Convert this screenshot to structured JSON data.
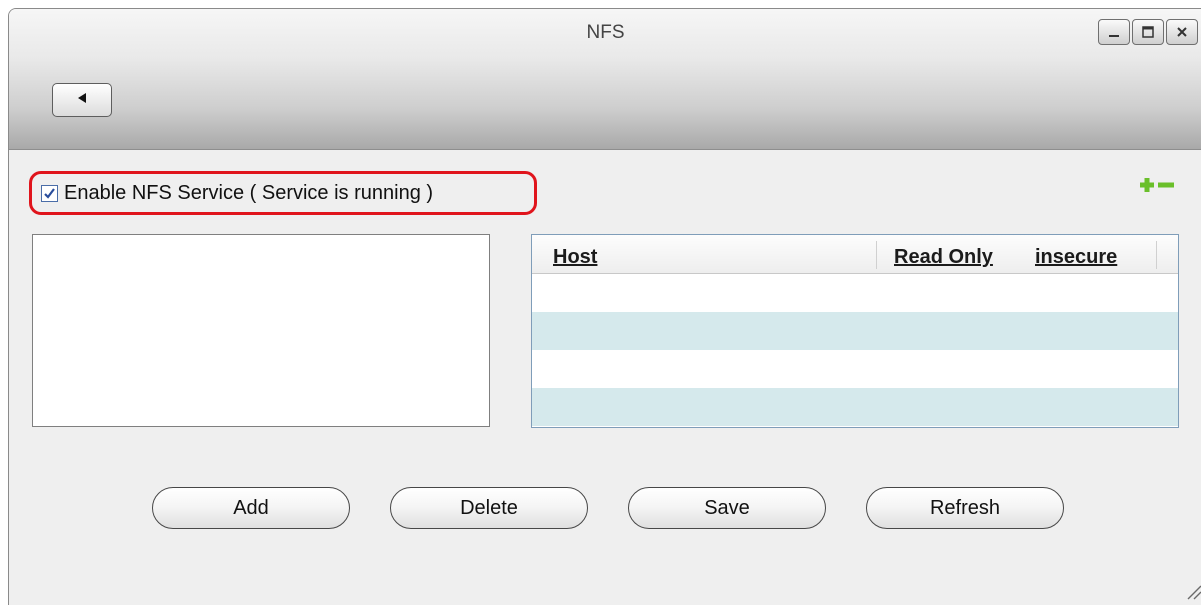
{
  "window": {
    "title": "NFS",
    "controls": [
      "minimize-icon",
      "maximize-icon",
      "close-icon"
    ]
  },
  "toolbar": {
    "back_icon": "back-arrow-icon"
  },
  "service": {
    "enabled": true,
    "label": "Enable NFS Service ( Service is running )",
    "highlight_color": "#e0141c"
  },
  "host_actions": {
    "add_icon": "plus-icon",
    "remove_icon": "minus-icon",
    "color": "#6abf2a"
  },
  "host_table": {
    "columns": [
      "Host",
      "Read Only",
      "insecure"
    ],
    "rows": [],
    "alt_row_color": "#d5e9ec"
  },
  "buttons": {
    "add": "Add",
    "delete": "Delete",
    "save": "Save",
    "refresh": "Refresh"
  }
}
